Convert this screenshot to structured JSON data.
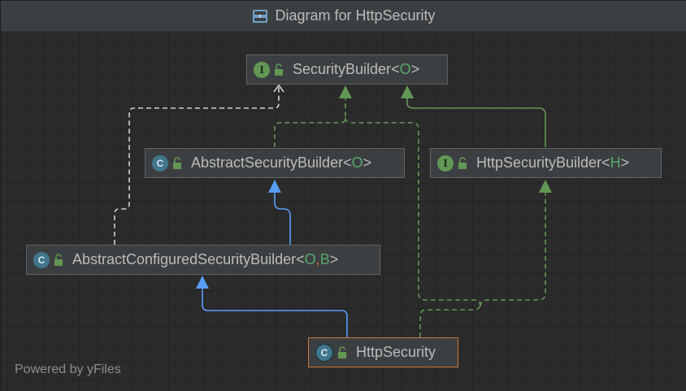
{
  "window": {
    "title": "Diagram for HttpSecurity"
  },
  "footer": {
    "powered_by": "Powered by yFiles"
  },
  "nodes": {
    "security_builder": {
      "kind": "interface",
      "badge": "I",
      "name": "SecurityBuilder",
      "open": "<",
      "params": [
        "O"
      ],
      "close": ">"
    },
    "abstract_security_builder": {
      "kind": "abstract-class",
      "badge": "C",
      "name": "AbstractSecurityBuilder",
      "open": "<",
      "params": [
        "O"
      ],
      "close": ">"
    },
    "http_security_builder": {
      "kind": "interface",
      "badge": "I",
      "name": "HttpSecurityBuilder",
      "open": "<",
      "params": [
        "H"
      ],
      "close": ">"
    },
    "abstract_configured_security_builder": {
      "kind": "abstract-class",
      "badge": "C",
      "name": "AbstractConfiguredSecurityBuilder",
      "open": "<",
      "params": [
        "O",
        ", ",
        "B"
      ],
      "close": ">"
    },
    "http_security": {
      "kind": "class",
      "badge": "C",
      "name": "HttpSecurity",
      "selected": true
    }
  },
  "colors": {
    "background": "#2b2b2b",
    "node_fill": "#3c3f41",
    "extends_arrow": "#589df6",
    "implements_arrow": "#629755",
    "dependency_arrow": "#d0d0d0",
    "selected_border": "#c9773c"
  }
}
